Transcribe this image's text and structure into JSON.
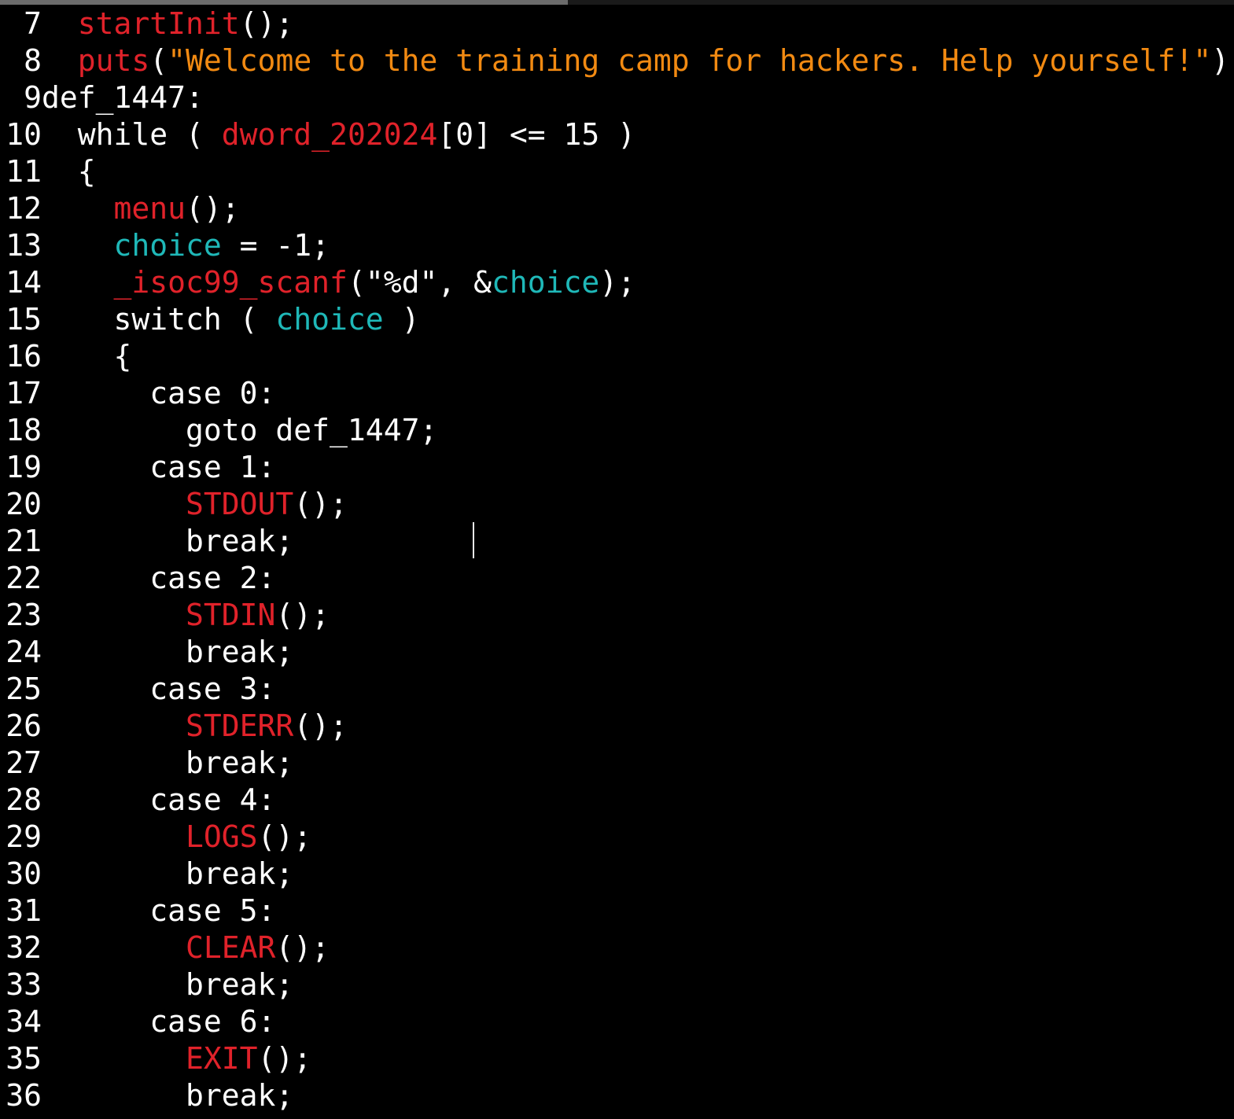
{
  "editor": {
    "lines": [
      {
        "number": "7",
        "indent": "  ",
        "segments": [
          {
            "text": "startInit",
            "kind": "fn"
          },
          {
            "text": "();",
            "kind": "plain"
          }
        ]
      },
      {
        "number": "8",
        "indent": "  ",
        "segments": [
          {
            "text": "puts",
            "kind": "fn"
          },
          {
            "text": "(",
            "kind": "plain"
          },
          {
            "text": "\"Welcome to the training camp for hackers. Help yourself!\"",
            "kind": "str"
          },
          {
            "text": ");",
            "kind": "plain"
          }
        ]
      },
      {
        "number": "9",
        "indent": "",
        "segments": [
          {
            "text": "def_1447:",
            "kind": "plain"
          }
        ]
      },
      {
        "number": "10",
        "indent": "  ",
        "segments": [
          {
            "text": "while ( ",
            "kind": "plain"
          },
          {
            "text": "dword_202024",
            "kind": "fn"
          },
          {
            "text": "[0] <= 15 )",
            "kind": "plain"
          }
        ]
      },
      {
        "number": "11",
        "indent": "  ",
        "segments": [
          {
            "text": "{",
            "kind": "plain"
          }
        ]
      },
      {
        "number": "12",
        "indent": "    ",
        "segments": [
          {
            "text": "menu",
            "kind": "fn"
          },
          {
            "text": "();",
            "kind": "plain"
          }
        ]
      },
      {
        "number": "13",
        "indent": "    ",
        "segments": [
          {
            "text": "choice",
            "kind": "var"
          },
          {
            "text": " = -1;",
            "kind": "plain"
          }
        ]
      },
      {
        "number": "14",
        "indent": "    ",
        "segments": [
          {
            "text": "_isoc99_scanf",
            "kind": "fn"
          },
          {
            "text": "(\"%d\", &",
            "kind": "plain"
          },
          {
            "text": "choice",
            "kind": "var"
          },
          {
            "text": ");",
            "kind": "plain"
          }
        ]
      },
      {
        "number": "15",
        "indent": "    ",
        "segments": [
          {
            "text": "switch ( ",
            "kind": "plain"
          },
          {
            "text": "choice",
            "kind": "var"
          },
          {
            "text": " )",
            "kind": "plain"
          }
        ]
      },
      {
        "number": "16",
        "indent": "    ",
        "segments": [
          {
            "text": "{",
            "kind": "plain"
          }
        ]
      },
      {
        "number": "17",
        "indent": "      ",
        "segments": [
          {
            "text": "case 0:",
            "kind": "plain"
          }
        ]
      },
      {
        "number": "18",
        "indent": "        ",
        "segments": [
          {
            "text": "goto def_1447;",
            "kind": "plain"
          }
        ]
      },
      {
        "number": "19",
        "indent": "      ",
        "segments": [
          {
            "text": "case 1:",
            "kind": "plain"
          }
        ]
      },
      {
        "number": "20",
        "indent": "        ",
        "segments": [
          {
            "text": "STDOUT",
            "kind": "fn"
          },
          {
            "text": "();",
            "kind": "plain"
          }
        ]
      },
      {
        "number": "21",
        "indent": "        ",
        "segments": [
          {
            "text": "break;",
            "kind": "plain"
          }
        ]
      },
      {
        "number": "22",
        "indent": "      ",
        "segments": [
          {
            "text": "case 2:",
            "kind": "plain"
          }
        ]
      },
      {
        "number": "23",
        "indent": "        ",
        "segments": [
          {
            "text": "STDIN",
            "kind": "fn"
          },
          {
            "text": "();",
            "kind": "plain"
          }
        ]
      },
      {
        "number": "24",
        "indent": "        ",
        "segments": [
          {
            "text": "break;",
            "kind": "plain"
          }
        ]
      },
      {
        "number": "25",
        "indent": "      ",
        "segments": [
          {
            "text": "case 3:",
            "kind": "plain"
          }
        ]
      },
      {
        "number": "26",
        "indent": "        ",
        "segments": [
          {
            "text": "STDERR",
            "kind": "fn"
          },
          {
            "text": "();",
            "kind": "plain"
          }
        ]
      },
      {
        "number": "27",
        "indent": "        ",
        "segments": [
          {
            "text": "break;",
            "kind": "plain"
          }
        ]
      },
      {
        "number": "28",
        "indent": "      ",
        "segments": [
          {
            "text": "case 4:",
            "kind": "plain"
          }
        ]
      },
      {
        "number": "29",
        "indent": "        ",
        "segments": [
          {
            "text": "LOGS",
            "kind": "fn"
          },
          {
            "text": "();",
            "kind": "plain"
          }
        ]
      },
      {
        "number": "30",
        "indent": "        ",
        "segments": [
          {
            "text": "break;",
            "kind": "plain"
          }
        ]
      },
      {
        "number": "31",
        "indent": "      ",
        "segments": [
          {
            "text": "case 5:",
            "kind": "plain"
          }
        ]
      },
      {
        "number": "32",
        "indent": "        ",
        "segments": [
          {
            "text": "CLEAR",
            "kind": "fn"
          },
          {
            "text": "();",
            "kind": "plain"
          }
        ]
      },
      {
        "number": "33",
        "indent": "        ",
        "segments": [
          {
            "text": "break;",
            "kind": "plain"
          }
        ]
      },
      {
        "number": "34",
        "indent": "      ",
        "segments": [
          {
            "text": "case 6:",
            "kind": "plain"
          }
        ]
      },
      {
        "number": "35",
        "indent": "        ",
        "segments": [
          {
            "text": "EXIT",
            "kind": "fn"
          },
          {
            "text": "();",
            "kind": "plain"
          }
        ]
      },
      {
        "number": "36",
        "indent": "        ",
        "segments": [
          {
            "text": "break;",
            "kind": "plain"
          }
        ]
      }
    ]
  },
  "colors": {
    "background": "#000000",
    "function": "#e0222a",
    "variable": "#1fb8b8",
    "string": "#f28a12",
    "plain": "#ffffff"
  }
}
